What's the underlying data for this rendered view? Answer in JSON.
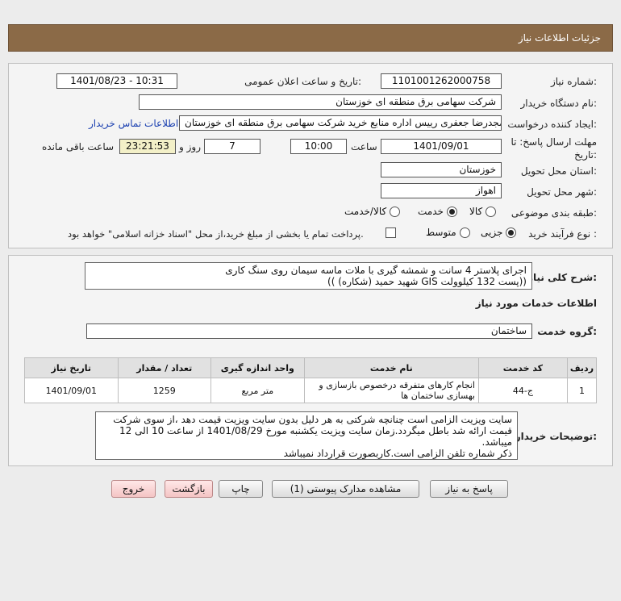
{
  "page_title": "جزئیات اطلاعات نیاز",
  "form": {
    "need_number_label": "شماره نیاز:",
    "need_number": "1101001262000758",
    "announce_label": "تاریخ و ساعت اعلان عمومی:",
    "announce_value": "1401/08/23 - 10:31",
    "buyer_org_label": "نام دستگاه خریدار:",
    "buyer_org": "شرکت سهامی برق منطقه ای خوزستان",
    "creator_label": "ایجاد کننده درخواست:",
    "creator": "مجدرضا جعفری رییس اداره منابع خرید شرکت سهامی برق منطقه ای خوزستان",
    "contact_link": "اطلاعات تماس خریدار",
    "deadline_label_1": "مهلت ارسال پاسخ: تا",
    "deadline_label_2": "تاریخ:",
    "deadline_date": "1401/09/01",
    "hour_label": "ساعت",
    "deadline_time": "10:00",
    "days_value": "7",
    "days_label": "روز و",
    "remaining_time": "23:21:53",
    "remaining_label": "ساعت باقی مانده",
    "province_label": "استان محل تحویل:",
    "province": "خوزستان",
    "city_label": "شهر محل تحویل:",
    "city": "اهواز",
    "category_label": "طبقه بندی موضوعی:",
    "category_options": [
      "کالا",
      "خدمت",
      "کالا/خدمت"
    ],
    "category_selected": "خدمت",
    "purchase_type_label": "نوع فرآیند خرید :",
    "purchase_options": [
      "جزیی",
      "متوسط"
    ],
    "purchase_selected": "جزیی",
    "payment_note": "پرداخت تمام یا بخشی از مبلغ خرید،از محل \"اسناد خزانه اسلامی\" خواهد بود."
  },
  "details": {
    "summary_label": "شرح کلی نیاز:",
    "summary_line1": "اجرای پلاستر 4 سانت و شمشه گیری با ملات ماسه سیمان روی سنگ کاری",
    "summary_line2": "((پست 132 کیلوولت GIS  شهید حمید (شکاره)    ))",
    "services_heading": "اطلاعات خدمات مورد نیاز",
    "service_group_label": "گروه خدمت:",
    "service_group": "ساختمان",
    "table_headers": [
      "ردیف",
      "کد خدمت",
      "نام خدمت",
      "واحد اندازه گیری",
      "تعداد / مقدار",
      "تاریخ نیاز"
    ],
    "table_rows": [
      {
        "row": "1",
        "code": "ج-44",
        "name": "انجام کارهای متفرقه درخصوص بازسازی و بهسازی ساختمان ها",
        "unit": "متر مربع",
        "qty": "1259",
        "date": "1401/09/01"
      }
    ],
    "buyer_notes_label": "توضیحات خریدار:",
    "buyer_notes_lines": [
      "سایت ویزیت الزامی است چنانچه شرکتی به هر دلیل بدون سایت ویزیت قیمت دهد ،از سوی شرکت",
      "قیمت ارائه شد باطل میگردد.زمان سایت ویزیت یکشنبه  مورخ 1401/08/29 از ساعت 10 الی 12",
      "میباشد.",
      "ذکر شماره تلفن الزامی است.کاربصورت قرارداد نمیباشد"
    ]
  },
  "buttons": {
    "reply": "پاسخ به نیاز",
    "view_docs": "مشاهده مدارک پیوستی (1)",
    "print": "چاپ",
    "back": "بازگشت",
    "exit": "خروج"
  },
  "colors": {
    "header_bg": "#8b6a47",
    "link": "#1a3fb0",
    "remaining_bg": "#f3f0c8",
    "red_button_bg": "#f4c4c4"
  }
}
